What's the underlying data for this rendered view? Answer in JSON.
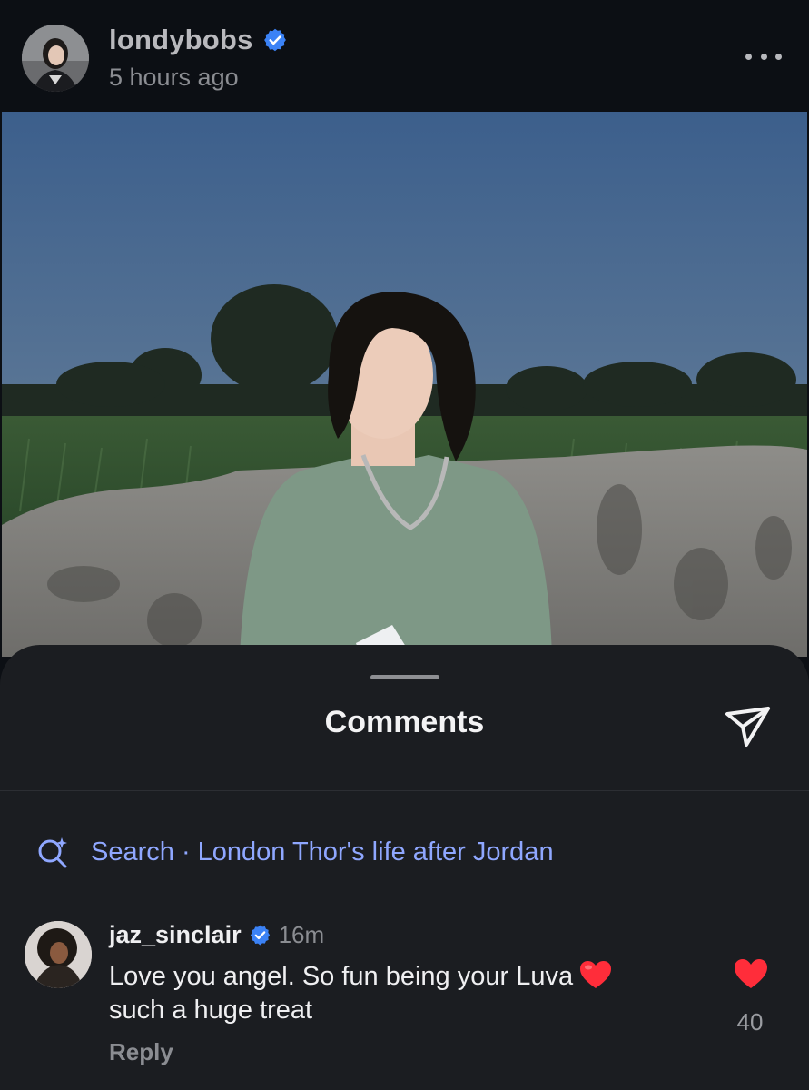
{
  "post": {
    "username": "londybobs",
    "verified": true,
    "time": "5 hours ago"
  },
  "icons": {
    "more": "more-horizontal-icon",
    "verified": "verified-badge-icon",
    "send": "send-paper-plane-icon",
    "search": "search-sparkle-icon",
    "like": "heart-filled-icon"
  },
  "colors": {
    "background": "#0c0f14",
    "sheet": "#1b1d21",
    "link": "#8fa7ff",
    "verified": "#3b82f6",
    "heart": "#ff2d3a"
  },
  "comments_sheet": {
    "title": "Comments",
    "search_label": "Search · London Thor's life after Jordan"
  },
  "comments": [
    {
      "username": "jaz_sinclair",
      "verified": true,
      "time": "16m",
      "text": "Love you angel. So fun being your Luva",
      "text_line2": "such a huge treat",
      "emoji": "red-heart",
      "reply_label": "Reply",
      "likes": "40",
      "liked": true
    }
  ]
}
